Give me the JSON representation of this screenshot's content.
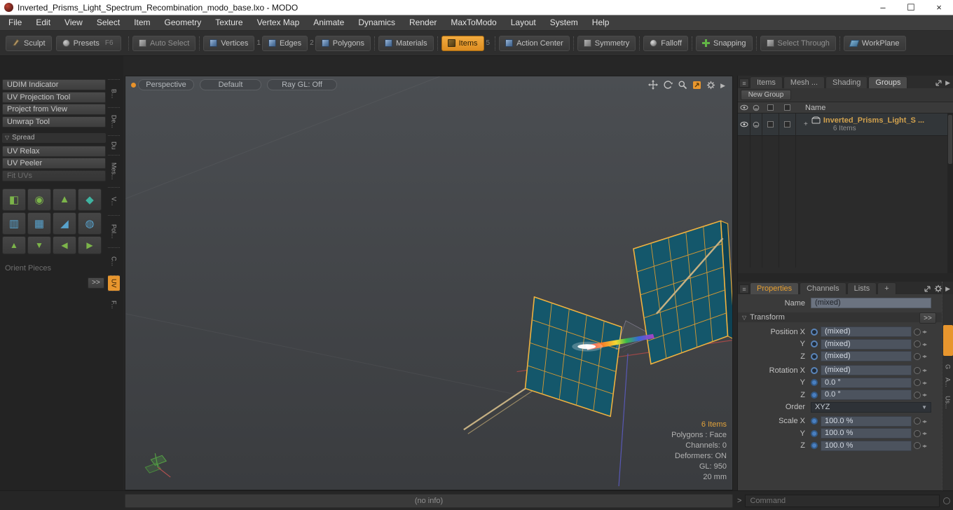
{
  "window": {
    "title": "Inverted_Prisms_Light_Spectrum_Recombination_modo_base.lxo - MODO"
  },
  "icons": {
    "minimize": "–",
    "maximize": "☐",
    "close": "×",
    "menu": "≡",
    "play": "▶",
    "dropdown": "▼",
    "section": "▽",
    "prompt": ">",
    "plus": "+",
    "mini": "◂▸",
    "arrow_up": "▲",
    "arrow_down": "▼",
    "arrow_left": "◀",
    "arrow_right": "▶"
  },
  "menubar": {
    "items": [
      "File",
      "Edit",
      "View",
      "Select",
      "Item",
      "Geometry",
      "Texture",
      "Vertex Map",
      "Animate",
      "Dynamics",
      "Render",
      "MaxToModo",
      "Layout",
      "System",
      "Help"
    ]
  },
  "toolbar": {
    "sculpt": "Sculpt",
    "presets": "Presets",
    "presets_shortcut": "F6",
    "modes": [
      {
        "label": "Auto Select",
        "shortcut": ""
      },
      {
        "label": "Vertices",
        "shortcut": "1"
      },
      {
        "label": "Edges",
        "shortcut": "2"
      },
      {
        "label": "Polygons",
        "shortcut": ""
      },
      {
        "label": "Materials",
        "shortcut": ""
      },
      {
        "label": "Items",
        "shortcut": "5"
      },
      {
        "label": "Action Center",
        "shortcut": ""
      },
      {
        "label": "Symmetry",
        "shortcut": ""
      },
      {
        "label": "Falloff",
        "shortcut": ""
      },
      {
        "label": "Snapping",
        "shortcut": ""
      },
      {
        "label": "Select Through",
        "shortcut": ""
      },
      {
        "label": "WorkPlane",
        "shortcut": ""
      }
    ]
  },
  "sidebar": {
    "tools": [
      "UDIM Indicator",
      "UV Projection Tool",
      "Project from View",
      "Unwrap Tool"
    ],
    "section": "Spread",
    "spread_tools": [
      "UV Relax",
      "UV Peeler",
      "Fit UVs"
    ],
    "icon_glyphs": [
      "◧",
      "◉",
      "▲",
      "◆",
      "▥",
      "▦",
      "◢",
      "◍"
    ],
    "orient": "Orient Pieces",
    "more": ">>",
    "tabs": [
      "B...",
      "De...",
      "Du",
      "Mes...",
      "V...",
      "Pol...",
      "C...",
      "UV",
      "F..."
    ]
  },
  "viewport": {
    "view_mode": "Perspective",
    "shading_mode": "Default",
    "raygl": "Ray GL: Off",
    "info": [
      "6 Items",
      "Polygons : Face",
      "Channels: 0",
      "Deformers: ON",
      "GL: 950",
      "20 mm"
    ],
    "status": "(no info)"
  },
  "right_top": {
    "tabs": [
      "Items",
      "Mesh ...",
      "Shading",
      "Groups"
    ],
    "new_group": "New Group",
    "name_header": "Name",
    "item_name": "Inverted_Prisms_Light_S ...",
    "item_count": "6 Items"
  },
  "properties": {
    "tabs": [
      "Properties",
      "Channels",
      "Lists",
      "+"
    ],
    "name_label": "Name",
    "name_value": "(mixed)",
    "section": "Transform",
    "rows": [
      {
        "label": "Position X",
        "value": "(mixed)"
      },
      {
        "label": "Y",
        "value": "(mixed)"
      },
      {
        "label": "Z",
        "value": "(mixed)"
      },
      {
        "label": "Rotation X",
        "value": "(mixed)"
      },
      {
        "label": "Y",
        "value": "0.0 °"
      },
      {
        "label": "Z",
        "value": "0.0 °"
      },
      {
        "label": "Order",
        "value": "XYZ"
      },
      {
        "label": "Scale X",
        "value": "100.0 %"
      },
      {
        "label": "Y",
        "value": "100.0 %"
      },
      {
        "label": "Z",
        "value": "100.0 %"
      }
    ],
    "more": ">>"
  },
  "right_edge": {
    "tabs": [
      "G",
      "A...",
      "Us..."
    ]
  },
  "command": {
    "placeholder": "Command"
  },
  "colors": {
    "accent": "#e8962e",
    "panel_teal": "#14576b",
    "wire_orange": "#f0b23f"
  }
}
